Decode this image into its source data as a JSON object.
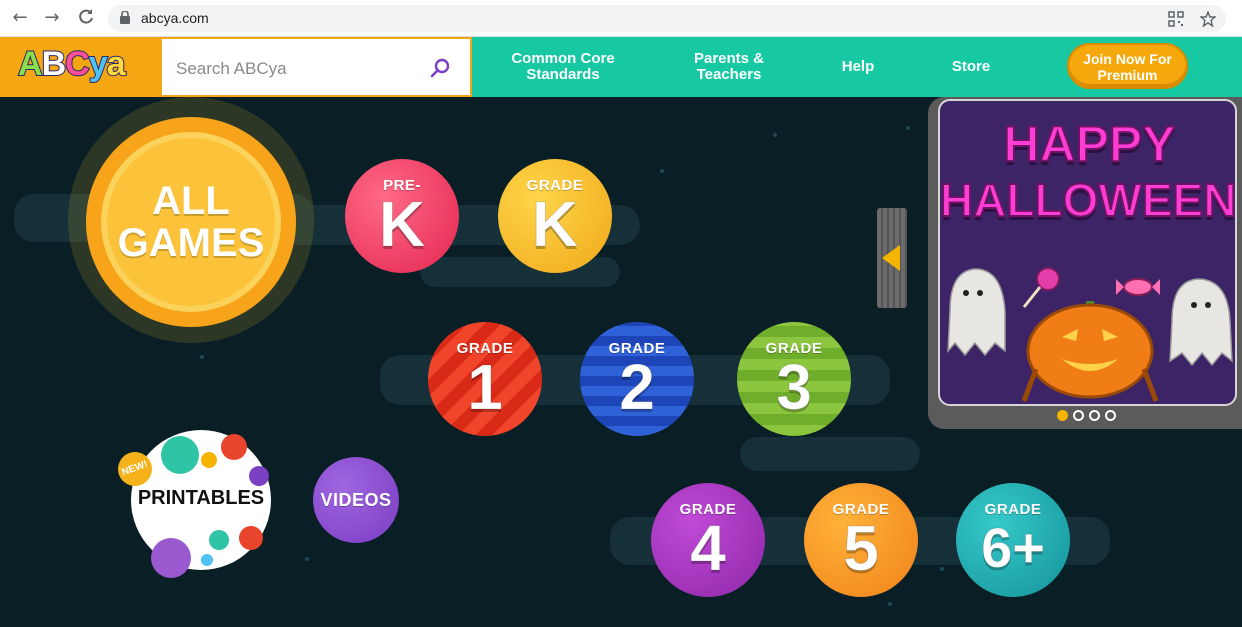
{
  "browser": {
    "url": "abcya.com"
  },
  "header": {
    "logo_text": "ABCya",
    "search_placeholder": "Search ABCya",
    "nav": [
      {
        "label": "Common Core Standards"
      },
      {
        "label": "Parents & Teachers"
      },
      {
        "label": "Help"
      },
      {
        "label": "Store"
      }
    ],
    "join_label": "Join Now For Premium",
    "colors": {
      "bar": "#17c9a3",
      "logo_bg": "#f5a613",
      "join_btn": "#f5a80c"
    }
  },
  "tiles": {
    "all_games": "ALL GAMES",
    "prek": {
      "small": "PRE-",
      "big": "K"
    },
    "gradek": {
      "small": "GRADE",
      "big": "K"
    },
    "grade1": {
      "small": "GRADE",
      "big": "1"
    },
    "grade2": {
      "small": "GRADE",
      "big": "2"
    },
    "grade3": {
      "small": "GRADE",
      "big": "3"
    },
    "grade4": {
      "small": "GRADE",
      "big": "4"
    },
    "grade5": {
      "small": "GRADE",
      "big": "5"
    },
    "grade6": {
      "small": "GRADE",
      "big": "6+"
    },
    "printables": "PRINTABLES",
    "new_badge": "NEW!",
    "videos": "VIDEOS"
  },
  "carousel": {
    "line1": "HAPPY",
    "line2": "HALLOWEEN!",
    "dot_count": 4,
    "active_dot": 0
  }
}
